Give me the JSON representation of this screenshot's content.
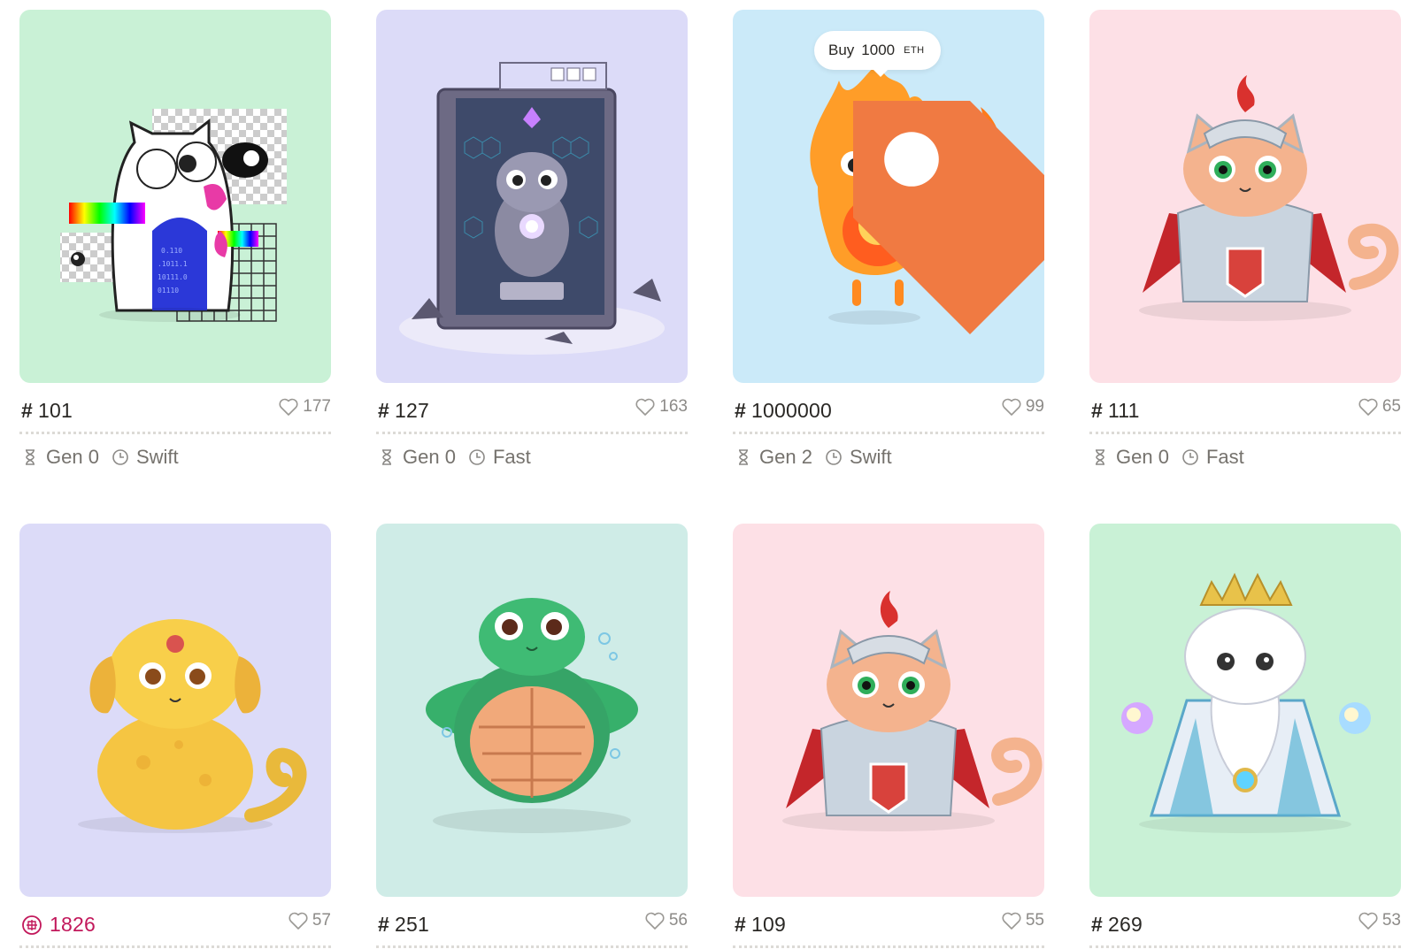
{
  "cards": [
    {
      "id": "101",
      "likes": "177",
      "gen": "Gen 0",
      "speed": "Swift",
      "bg": "#c9f1d6",
      "art": "glitch-cat"
    },
    {
      "id": "127",
      "likes": "163",
      "gen": "Gen 0",
      "speed": "Fast",
      "bg": "#dcdbf8",
      "art": "portal-cat"
    },
    {
      "id": "1000000",
      "likes": "99",
      "gen": "Gen 2",
      "speed": "Swift",
      "bg": "#cbeaf9",
      "art": "fire-cat",
      "buy": {
        "label": "Buy",
        "amount": "1000",
        "unit": "ETH"
      }
    },
    {
      "id": "111",
      "likes": "65",
      "gen": "Gen 0",
      "speed": "Fast",
      "bg": "#fde0e6",
      "art": "knight-cat"
    },
    {
      "id": "1826",
      "likes": "57",
      "special": true,
      "bg": "#dcdbf8",
      "art": "golden-dog-cat"
    },
    {
      "id": "251",
      "likes": "56",
      "bg": "#cfece7",
      "art": "turtle-cat"
    },
    {
      "id": "109",
      "likes": "55",
      "bg": "#fde0e6",
      "art": "knight-cat"
    },
    {
      "id": "269",
      "likes": "53",
      "bg": "#c9f1d6",
      "art": "wizard-cat"
    }
  ],
  "hash_symbol": "#",
  "colors": {
    "accent_special": "#c2185b",
    "muted": "#8c8a87"
  }
}
